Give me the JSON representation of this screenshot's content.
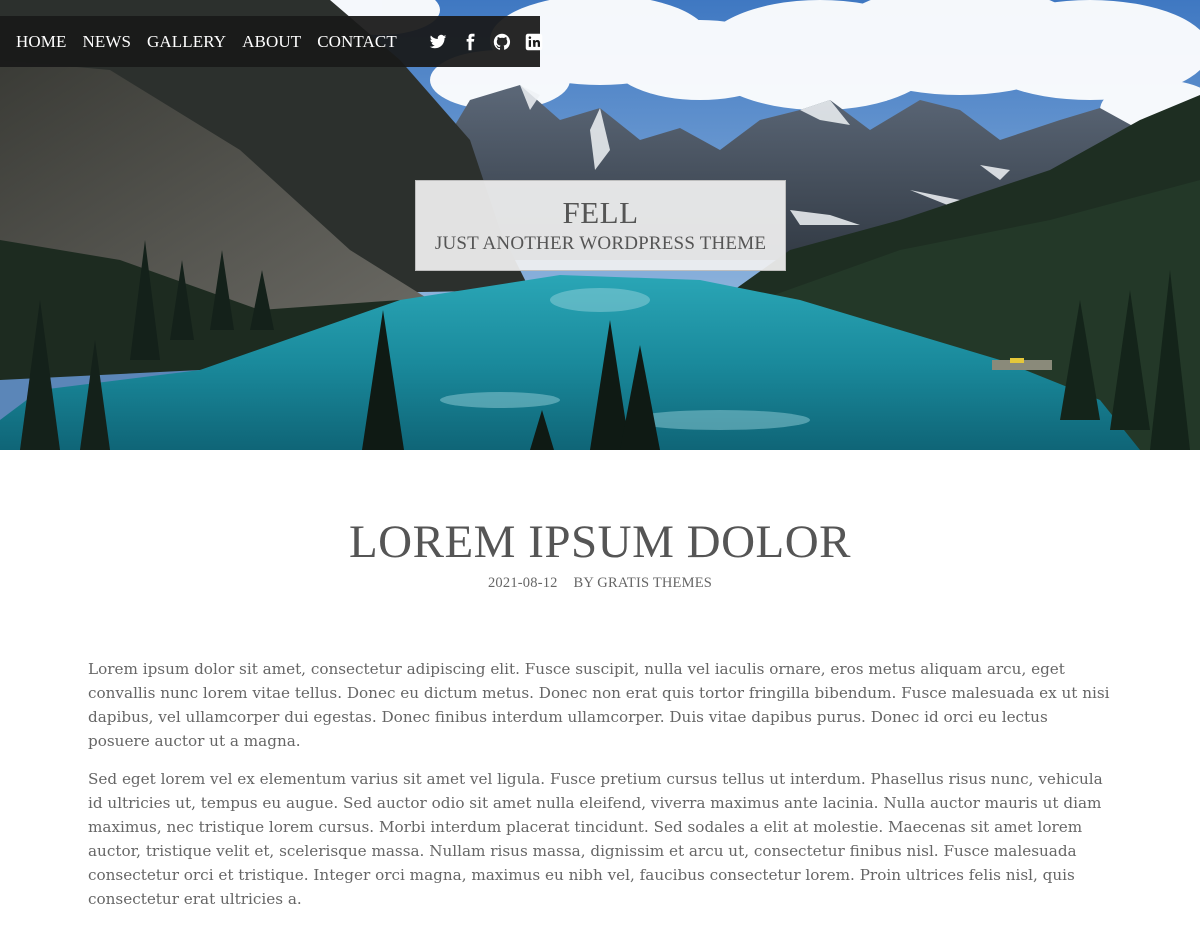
{
  "nav": {
    "links": [
      "HOME",
      "NEWS",
      "GALLERY",
      "ABOUT",
      "CONTACT"
    ],
    "social": [
      {
        "name": "twitter-icon"
      },
      {
        "name": "facebook-icon"
      },
      {
        "name": "github-icon"
      },
      {
        "name": "linkedin-icon"
      }
    ]
  },
  "branding": {
    "title": "FELL",
    "description": "JUST ANOTHER WORDPRESS THEME"
  },
  "post": {
    "title": "LOREM IPSUM DOLOR",
    "date": "2021-08-12",
    "author": "BY GRATIS THEMES",
    "paragraphs": [
      "Lorem ipsum dolor sit amet, consectetur adipiscing elit. Fusce suscipit, nulla vel iaculis ornare, eros metus aliquam arcu, eget convallis nunc lorem vitae tellus. Donec eu dictum metus. Donec non erat quis tortor fringilla bibendum. Fusce malesuada ex ut nisi dapibus, vel ullamcorper dui egestas. Donec finibus interdum ullamcorper. Duis vitae dapibus purus. Donec id orci eu lectus posuere auctor ut a magna.",
      "Sed eget lorem vel ex elementum varius sit amet vel ligula. Fusce pretium cursus tellus ut interdum. Phasellus risus nunc, vehicula id ultricies ut, tempus eu augue. Sed auctor odio sit amet nulla eleifend, viverra maximus ante lacinia. Nulla auctor mauris ut diam maximus, nec tristique lorem cursus. Morbi interdum placerat tincidunt. Sed sodales a elit at molestie. Maecenas sit amet lorem auctor, tristique velit et, scelerisque massa. Nullam risus massa, dignissim et arcu ut, consectetur finibus nisl. Fusce malesuada consectetur orci et tristique. Integer orci magna, maximus eu nibh vel, faucibus consectetur lorem. Proin ultrices felis nisl, quis consectetur erat ultricies a."
    ]
  },
  "colors": {
    "nav_bg": "#1a1a1a",
    "text": "#555555",
    "lake": "#1f8ea0",
    "sky": "#4a7fbf"
  }
}
